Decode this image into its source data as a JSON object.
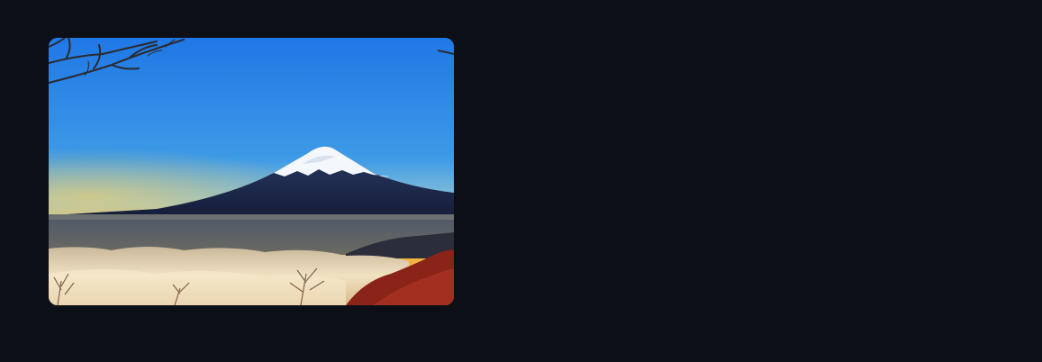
{
  "photo": {
    "subject_icon": "mountain-landscape-photo",
    "colors": {
      "sky_top": "#1f7ae8",
      "sky_mid": "#4aa6e6",
      "horizon_glow": "#f2b544",
      "mountain": "#1d2a4d",
      "snow": "#f4f7fb",
      "clouds": "#e9d8b8",
      "foliage": "#8a2318",
      "page_background": "#0c0f15"
    }
  }
}
